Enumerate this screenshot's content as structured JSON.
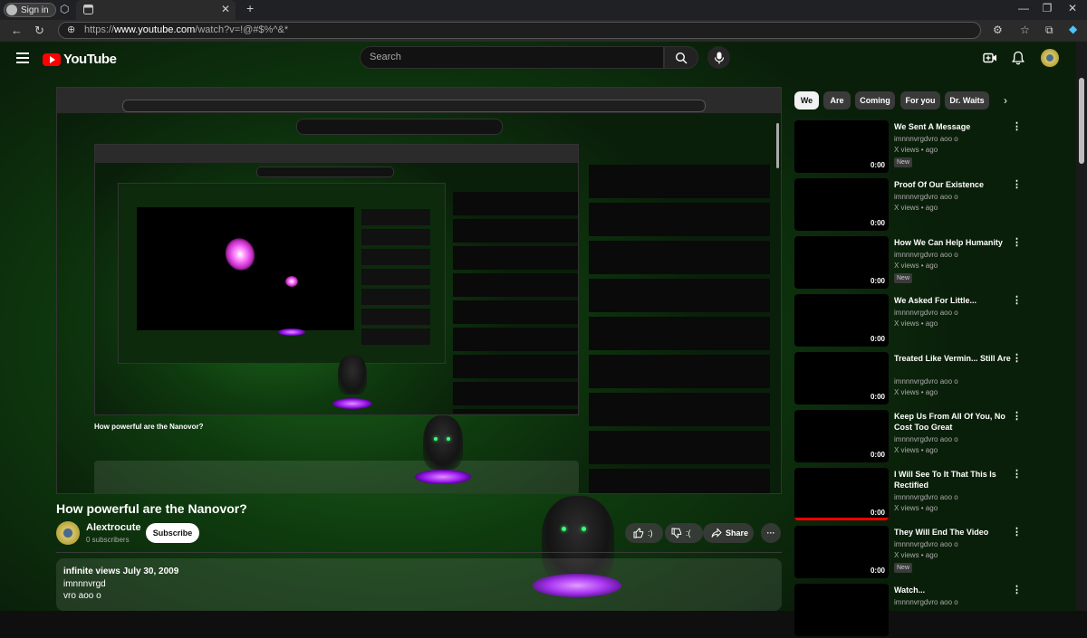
{
  "browser": {
    "signin_label": "Sign in",
    "url_prefix": "https://",
    "url_host": "www.youtube.com",
    "url_path": "/watch?v=!@#$%^&*"
  },
  "header": {
    "logo_text": "YouTube",
    "search_placeholder": "Search"
  },
  "video": {
    "title": "How powerful are the Nanovor?",
    "channel": "Alextrocute",
    "subscribers": "0 subscribers",
    "subscribe_label": "Subscribe",
    "like_count": ":)",
    "dislike_count": ":(",
    "share_label": "Share",
    "more_label": "···"
  },
  "description": {
    "views_date": "infinite views  July 30, 2009",
    "line2": "imnnnvrgd",
    "line3": "vro aoo o"
  },
  "chips": [
    "We",
    "Are",
    "Coming",
    "For you",
    "Dr. Waits"
  ],
  "recommendations": [
    {
      "title": "We Sent A Message",
      "channel": "imnnnvrgdvro aoo o",
      "meta": "X views  •  ago",
      "duration": "0:00",
      "badge": "New",
      "progress": 0
    },
    {
      "title": "Proof Of Our Existence",
      "channel": "imnnnvrgdvro aoo o",
      "meta": "X views  •  ago",
      "duration": "0:00",
      "badge": "",
      "progress": 0
    },
    {
      "title": "How We Can Help Humanity",
      "channel": "imnnnvrgdvro aoo o",
      "meta": "X views  •  ago",
      "duration": "0:00",
      "badge": "New",
      "progress": 0
    },
    {
      "title": "We Asked For Little...",
      "channel": "imnnnvrgdvro aoo o",
      "meta": "X views  •  ago",
      "duration": "0:00",
      "badge": "",
      "progress": 0
    },
    {
      "title": "Treated Like Vermin... Still Are",
      "channel": "imnnnvrgdvro aoo o",
      "meta": "X views  •  ago",
      "duration": "0:00",
      "badge": "",
      "progress": 0
    },
    {
      "title": "Keep Us From All Of You, No Cost Too Great",
      "channel": "imnnnvrgdvro aoo o",
      "meta": "X views  •  ago",
      "duration": "0:00",
      "badge": "",
      "progress": 0
    },
    {
      "title": "I Will See To It That This Is Rectified",
      "channel": "imnnnvrgdvro aoo o",
      "meta": "X views  •  ago",
      "duration": "0:00",
      "badge": "",
      "progress": 1
    },
    {
      "title": "They Will End The Video",
      "channel": "imnnnvrgdvro aoo o",
      "meta": "X views  •  ago",
      "duration": "0:00",
      "badge": "New",
      "progress": 0
    },
    {
      "title": "Watch...",
      "channel": "imnnnvrgdvro aoo o",
      "meta": "",
      "duration": "",
      "badge": "",
      "progress": 0
    }
  ]
}
